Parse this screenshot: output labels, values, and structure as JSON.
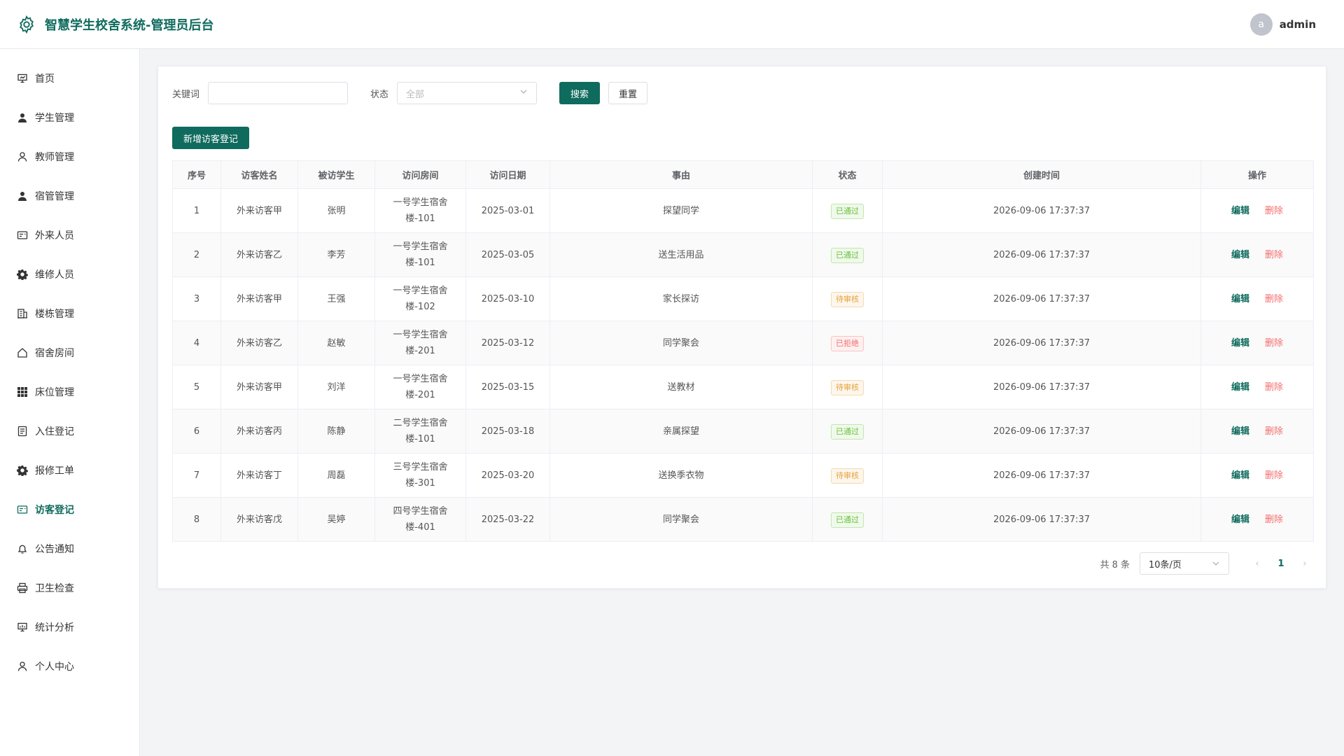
{
  "header": {
    "title": "智慧学生校舍系统-管理员后台",
    "avatar_letter": "a",
    "username": "admin"
  },
  "sidebar": {
    "items": [
      {
        "label": "首页",
        "icon": "dashboard-icon"
      },
      {
        "label": "学生管理",
        "icon": "user-solid-icon"
      },
      {
        "label": "教师管理",
        "icon": "user-icon"
      },
      {
        "label": "宿管管理",
        "icon": "user-solid-icon"
      },
      {
        "label": "外来人员",
        "icon": "postcard-icon"
      },
      {
        "label": "维修人员",
        "icon": "gear-icon"
      },
      {
        "label": "楼栋管理",
        "icon": "building-icon"
      },
      {
        "label": "宿舍房间",
        "icon": "house-icon"
      },
      {
        "label": "床位管理",
        "icon": "grid-icon"
      },
      {
        "label": "入住登记",
        "icon": "document-icon"
      },
      {
        "label": "报修工单",
        "icon": "gear-icon"
      },
      {
        "label": "访客登记",
        "icon": "postcard-icon",
        "active": true
      },
      {
        "label": "公告通知",
        "icon": "bell-icon"
      },
      {
        "label": "卫生检查",
        "icon": "printer-icon"
      },
      {
        "label": "统计分析",
        "icon": "chart-icon"
      },
      {
        "label": "个人中心",
        "icon": "user-icon"
      }
    ]
  },
  "filters": {
    "keyword_label": "关键词",
    "keyword_value": "",
    "status_label": "状态",
    "status_placeholder": "全部",
    "search_label": "搜索",
    "reset_label": "重置"
  },
  "add_button": "新增访客登记",
  "table": {
    "columns": [
      "序号",
      "访客姓名",
      "被访学生",
      "访问房间",
      "访问日期",
      "事由",
      "状态",
      "创建时间",
      "操作"
    ],
    "rows": [
      {
        "no": "1",
        "visitor": "外来访客甲",
        "student": "张明",
        "room_line1": "一号学生宿舍",
        "room_line2": "楼-101",
        "date": "2025-03-01",
        "reason": "探望同学",
        "status": "已通过",
        "status_type": "ok",
        "created": "2026-09-06 17:37:37"
      },
      {
        "no": "2",
        "visitor": "外来访客乙",
        "student": "李芳",
        "room_line1": "一号学生宿舍",
        "room_line2": "楼-101",
        "date": "2025-03-05",
        "reason": "送生活用品",
        "status": "已通过",
        "status_type": "ok",
        "created": "2026-09-06 17:37:37"
      },
      {
        "no": "3",
        "visitor": "外来访客甲",
        "student": "王强",
        "room_line1": "一号学生宿舍",
        "room_line2": "楼-102",
        "date": "2025-03-10",
        "reason": "家长探访",
        "status": "待审核",
        "status_type": "wait",
        "created": "2026-09-06 17:37:37"
      },
      {
        "no": "4",
        "visitor": "外来访客乙",
        "student": "赵敏",
        "room_line1": "一号学生宿舍",
        "room_line2": "楼-201",
        "date": "2025-03-12",
        "reason": "同学聚会",
        "status": "已拒绝",
        "status_type": "no",
        "created": "2026-09-06 17:37:37"
      },
      {
        "no": "5",
        "visitor": "外来访客甲",
        "student": "刘洋",
        "room_line1": "一号学生宿舍",
        "room_line2": "楼-201",
        "date": "2025-03-15",
        "reason": "送教材",
        "status": "待审核",
        "status_type": "wait",
        "created": "2026-09-06 17:37:37"
      },
      {
        "no": "6",
        "visitor": "外来访客丙",
        "student": "陈静",
        "room_line1": "二号学生宿舍",
        "room_line2": "楼-101",
        "date": "2025-03-18",
        "reason": "亲属探望",
        "status": "已通过",
        "status_type": "ok",
        "created": "2026-09-06 17:37:37"
      },
      {
        "no": "7",
        "visitor": "外来访客丁",
        "student": "周磊",
        "room_line1": "三号学生宿舍",
        "room_line2": "楼-301",
        "date": "2025-03-20",
        "reason": "送换季衣物",
        "status": "待审核",
        "status_type": "wait",
        "created": "2026-09-06 17:37:37"
      },
      {
        "no": "8",
        "visitor": "外来访客戊",
        "student": "吴婷",
        "room_line1": "四号学生宿舍",
        "room_line2": "楼-401",
        "date": "2025-03-22",
        "reason": "同学聚会",
        "status": "已通过",
        "status_type": "ok",
        "created": "2026-09-06 17:37:37"
      }
    ],
    "edit_label": "编辑",
    "delete_label": "删除"
  },
  "pagination": {
    "total_text": "共 8 条",
    "page_size": "10条/页",
    "current_page": "1"
  },
  "colors": {
    "primary": "#0f6b5e",
    "danger": "#f56c6c",
    "success": "#67c23a",
    "warning": "#e6a23c"
  }
}
